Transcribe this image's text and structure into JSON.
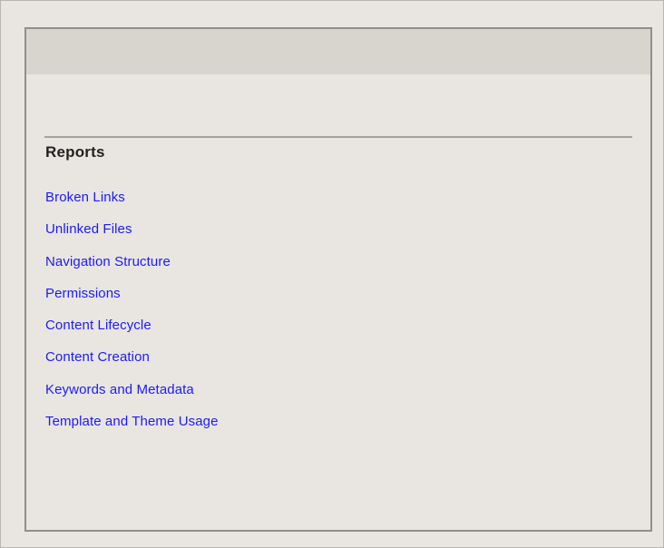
{
  "reports": {
    "title": "Reports",
    "items": [
      {
        "label": "Broken Links"
      },
      {
        "label": "Unlinked Files"
      },
      {
        "label": "Navigation Structure"
      },
      {
        "label": "Permissions"
      },
      {
        "label": "Content Lifecycle"
      },
      {
        "label": "Content Creation"
      },
      {
        "label": "Keywords and Metadata"
      },
      {
        "label": "Template and Theme Usage"
      }
    ]
  },
  "colors": {
    "background": "#e9e6e1",
    "header_bar": "#d8d5cf",
    "link": "#1c1cf0",
    "heading": "#222222",
    "border": "#8f8f8f"
  }
}
